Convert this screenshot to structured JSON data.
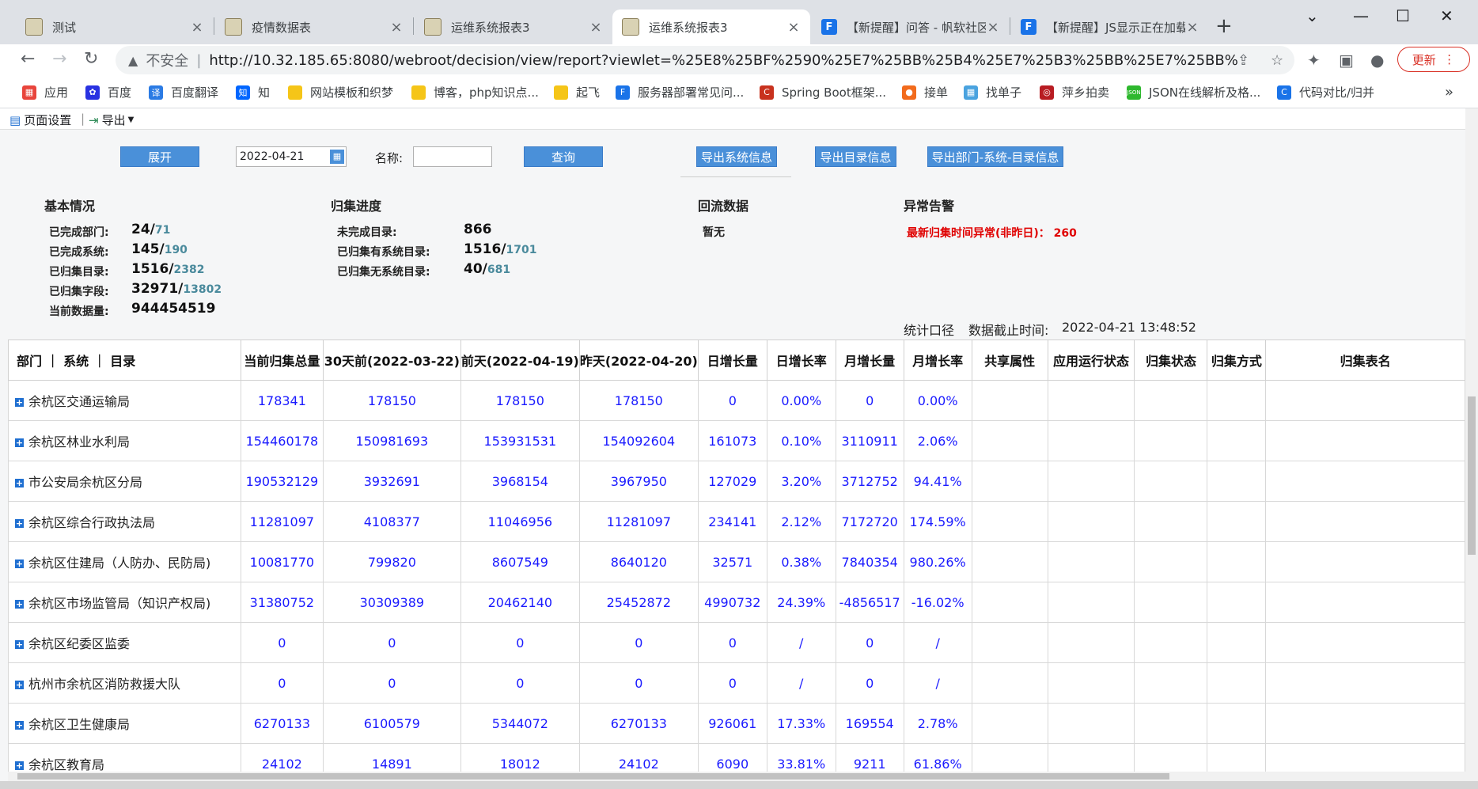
{
  "browser": {
    "tabs": [
      {
        "title": "测试",
        "icon": "tiger-icon",
        "active": false
      },
      {
        "title": "疫情数据表",
        "icon": "tiger-icon",
        "active": false
      },
      {
        "title": "运维系统报表3",
        "icon": "tiger-icon",
        "active": false
      },
      {
        "title": "运维系统报表3",
        "icon": "tiger-icon",
        "active": true
      },
      {
        "title": "【新提醒】问答 - 帆软社区",
        "icon": "fanruan-icon",
        "active": false
      },
      {
        "title": "【新提醒】JS显示正在加载",
        "icon": "fanruan-icon",
        "active": false
      }
    ],
    "insecure_label": "不安全",
    "url": "http://10.32.185.65:8080/webroot/decision/view/report?viewlet=%25E8%25BF%2590%25E7%25BB%25B4%25E7%25B3%25BB%25E7%25BB%259F%25E...",
    "update_label": "更新",
    "bookmarks": [
      {
        "label": "应用",
        "icon": "apps-grid-icon",
        "color": "#e8453c"
      },
      {
        "label": "百度",
        "icon": "baidu-paw-icon",
        "color": "#2932e1"
      },
      {
        "label": "百度翻译",
        "icon": "translate-icon",
        "color": "#2b7be4"
      },
      {
        "label": "知",
        "icon": "zhihu-icon",
        "color": "#0066ff"
      },
      {
        "label": "网站模板和织梦",
        "icon": "folder-icon",
        "color": "#f5c518"
      },
      {
        "label": "博客，php知识点...",
        "icon": "folder-icon",
        "color": "#f5c518"
      },
      {
        "label": "起飞",
        "icon": "folder-icon",
        "color": "#f5c518"
      },
      {
        "label": "服务器部署常见问...",
        "icon": "fanruan-icon",
        "color": "#1a73e8"
      },
      {
        "label": "Spring Boot框架...",
        "icon": "csdn-icon",
        "color": "#c8321e"
      },
      {
        "label": "接单",
        "icon": "order-icon",
        "color": "#f26b1d"
      },
      {
        "label": "找单子",
        "icon": "grid-icon",
        "color": "#4aa3df"
      },
      {
        "label": "萍乡拍卖",
        "icon": "auction-icon",
        "color": "#b81c22"
      },
      {
        "label": "JSON在线解析及格...",
        "icon": "json-icon",
        "color": "#2eb82e"
      },
      {
        "label": "代码对比/归并",
        "icon": "compare-icon",
        "color": "#1a73e8"
      }
    ]
  },
  "report": {
    "toolbar": {
      "page_setup": "页面设置",
      "export": "导出"
    },
    "filters": {
      "expand_label": "展开",
      "date_value": "2022-04-21",
      "name_label": "名称:",
      "query_label": "查询",
      "export_system": "导出系统信息",
      "export_catalog": "导出目录信息",
      "export_dept": "导出部门-系统-目录信息"
    },
    "basic": {
      "title": "基本情况",
      "rows": [
        {
          "label": "已完成部门:",
          "main": "24/",
          "sub": "71"
        },
        {
          "label": "已完成系统:",
          "main": "145/",
          "sub": "190"
        },
        {
          "label": "已归集目录:",
          "main": "1516/",
          "sub": "2382"
        },
        {
          "label": "已归集字段:",
          "main": "32971/",
          "sub": "13802"
        },
        {
          "label": "当前数据量:",
          "main": "944454519",
          "sub": ""
        }
      ]
    },
    "progress": {
      "title": "归集进度",
      "rows": [
        {
          "label": "未完成目录:",
          "main": "866",
          "sub": ""
        },
        {
          "label": "已归集有系统目录:",
          "main": "1516/",
          "sub": "1701"
        },
        {
          "label": "已归集无系统目录:",
          "main": "40/",
          "sub": "681"
        }
      ]
    },
    "backflow": {
      "title": "回流数据",
      "value": "暂无"
    },
    "alarm": {
      "title": "异常告警",
      "text": "最新归集时间异常(非昨日)： 260"
    },
    "meta": {
      "scope": "统计口径",
      "cutoff_label": "数据截止时间:",
      "cutoff_value": "2022-04-21 13:48:52"
    },
    "table": {
      "headers": [
        "部门 ｜ 系统 ｜ 目录",
        "当前归集总量",
        "30天前(2022-03-22)",
        "前天(2022-04-19)",
        "昨天(2022-04-20)",
        "日增长量",
        "日增长率",
        "月增长量",
        "月增长率",
        "共享属性",
        "应用运行状态",
        "归集状态",
        "归集方式",
        "归集表名"
      ],
      "rows": [
        [
          "余杭区交通运输局",
          "178341",
          "178150",
          "178150",
          "178150",
          "0",
          "0.00%",
          "0",
          "0.00%"
        ],
        [
          "余杭区林业水利局",
          "154460178",
          "150981693",
          "153931531",
          "154092604",
          "161073",
          "0.10%",
          "3110911",
          "2.06%"
        ],
        [
          "市公安局余杭区分局",
          "190532129",
          "3932691",
          "3968154",
          "3967950",
          "127029",
          "3.20%",
          "3712752",
          "94.41%"
        ],
        [
          "余杭区综合行政执法局",
          "11281097",
          "4108377",
          "11046956",
          "11281097",
          "234141",
          "2.12%",
          "7172720",
          "174.59%"
        ],
        [
          "余杭区住建局（人防办、民防局)",
          "10081770",
          "799820",
          "8607549",
          "8640120",
          "32571",
          "0.38%",
          "7840354",
          "980.26%"
        ],
        [
          "余杭区市场监管局（知识产权局)",
          "31380752",
          "30309389",
          "20462140",
          "25452872",
          "4990732",
          "24.39%",
          "-4856517",
          "-16.02%"
        ],
        [
          "余杭区纪委区监委",
          "0",
          "0",
          "0",
          "0",
          "0",
          "/",
          "0",
          "/"
        ],
        [
          "杭州市余杭区消防救援大队",
          "0",
          "0",
          "0",
          "0",
          "0",
          "/",
          "0",
          "/"
        ],
        [
          "余杭区卫生健康局",
          "6270133",
          "6100579",
          "5344072",
          "6270133",
          "926061",
          "17.33%",
          "169554",
          "2.78%"
        ],
        [
          "余杭区教育局",
          "24102",
          "14891",
          "18012",
          "24102",
          "6090",
          "33.81%",
          "9211",
          "61.86%"
        ]
      ]
    }
  }
}
